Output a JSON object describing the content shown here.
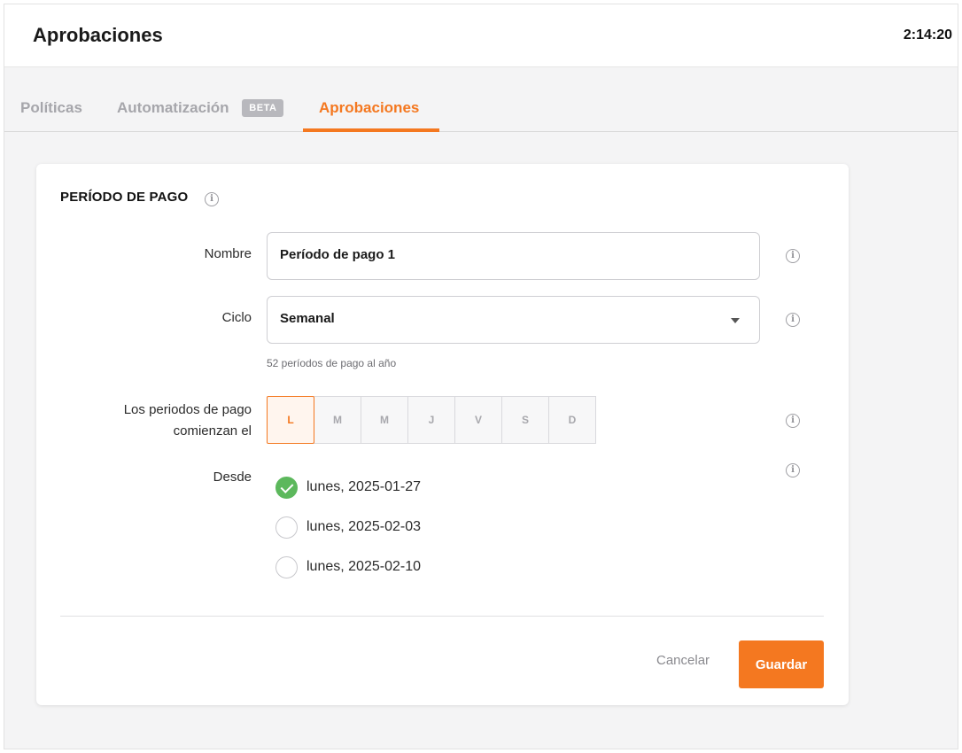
{
  "header": {
    "title": "Aprobaciones",
    "time": "2:14:20"
  },
  "tabs": [
    {
      "label": "Políticas",
      "active": false
    },
    {
      "label": "Automatización",
      "badge": "BETA",
      "active": false
    },
    {
      "label": "Aprobaciones",
      "active": true
    }
  ],
  "card": {
    "title": "PERÍODO DE PAGO",
    "nombre": {
      "label": "Nombre",
      "value": "Período de pago 1"
    },
    "ciclo": {
      "label": "Ciclo",
      "value": "Semanal",
      "hint": "52 períodos de pago al año"
    },
    "start_day": {
      "label_line1": "Los periodos de pago",
      "label_line2": "comienzan el",
      "days": [
        "L",
        "M",
        "M",
        "J",
        "V",
        "S",
        "D"
      ],
      "selected": "L"
    },
    "desde": {
      "label": "Desde",
      "options": [
        {
          "label": "lunes, 2025-01-27",
          "checked": true
        },
        {
          "label": "lunes, 2025-02-03",
          "checked": false
        },
        {
          "label": "lunes, 2025-02-10",
          "checked": false
        }
      ]
    },
    "actions": {
      "cancel_label": "Cancelar",
      "save_label": "Guardar"
    }
  },
  "colors": {
    "accent": "#f47820",
    "success": "#5cb85c",
    "muted_tab": "#a6a6ab"
  },
  "icons": {
    "info": "info-circle-icon",
    "dropdown": "caret-down-icon",
    "check": "check-icon"
  }
}
